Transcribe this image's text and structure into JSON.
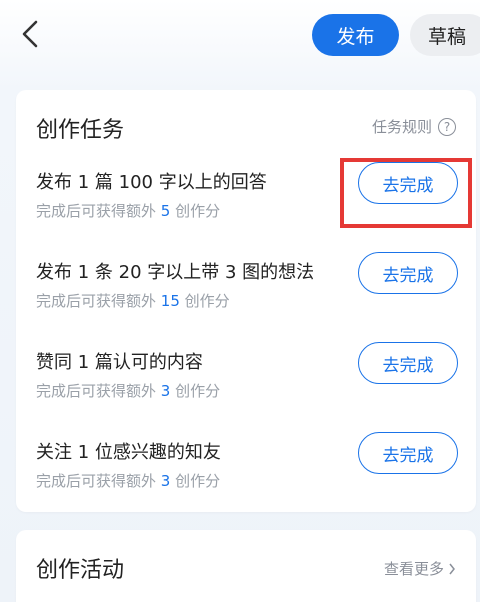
{
  "header": {
    "publish_label": "发布",
    "draft_label": "草稿"
  },
  "tasks_card": {
    "title": "创作任务",
    "rules_label": "任务规则",
    "tasks": [
      {
        "title": "发布 1 篇 100 字以上的回答",
        "sub_prefix": "完成后可获得额外 ",
        "points": "5",
        "sub_suffix": " 创作分",
        "button": "去完成"
      },
      {
        "title": "发布 1 条 20 字以上带 3 图的想法",
        "sub_prefix": "完成后可获得额外 ",
        "points": "15",
        "sub_suffix": " 创作分",
        "button": "去完成"
      },
      {
        "title": "赞同 1 篇认可的内容",
        "sub_prefix": "完成后可获得额外 ",
        "points": "3",
        "sub_suffix": " 创作分",
        "button": "去完成"
      },
      {
        "title": "关注 1 位感兴趣的知友",
        "sub_prefix": "完成后可获得额外 ",
        "points": "3",
        "sub_suffix": " 创作分",
        "button": "去完成"
      }
    ]
  },
  "activity_card": {
    "title": "创作活动",
    "more_label": "查看更多"
  },
  "colors": {
    "accent": "#1a73e8",
    "highlight": "#e53935"
  }
}
